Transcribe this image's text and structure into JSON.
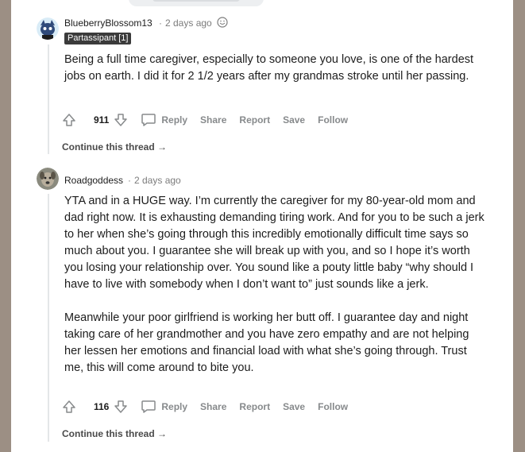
{
  "comments": [
    {
      "username": "BlueberryBlossom13",
      "time": "2 days ago",
      "flair": "Partassipant [1]",
      "paragraphs": [
        "Being a full time caregiver, especially to someone you love, is one of the hardest jobs on earth. I did it for 2 1/2 years after my grandmas stroke until her passing."
      ],
      "votes": "911"
    },
    {
      "username": "Roadgoddess",
      "time": "2 days ago",
      "paragraphs": [
        "YTA and in a HUGE way. I’m currently the caregiver for my 80-year-old mom and dad right now. It is exhausting demanding tiring work. And for you to be such a jerk to her when she’s going through this incredibly emotionally difficult time says so much about you. I guarantee she will break up with you, and so I hope it’s worth you losing your relationship over. You sound like a pouty little baby “why should I have to live with somebody when I don’t want to” just sounds like a jerk.",
        "Meanwhile your poor girlfriend is working her butt off. I guarantee day and night taking care of her grandmother and you have zero empathy and are not helping her lessen her emotions and financial load with what she’s going through. Trust me, this will come around to bite you."
      ],
      "votes": "116"
    }
  ],
  "actions": {
    "reply": "Reply",
    "share": "Share",
    "report": "Report",
    "save": "Save",
    "follow": "Follow"
  },
  "continue_thread": "Continue this thread",
  "separator": "·"
}
